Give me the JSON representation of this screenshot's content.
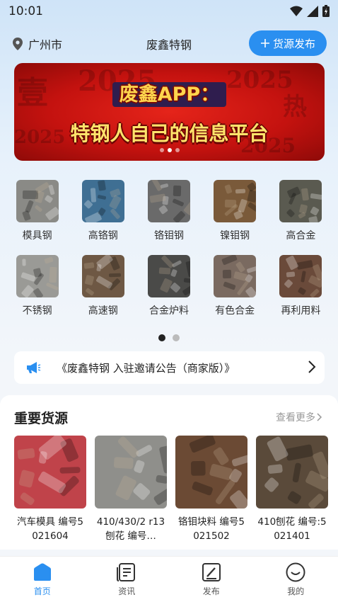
{
  "status": {
    "time": "10:01"
  },
  "header": {
    "location": "广州市",
    "title": "废鑫特钢",
    "publish_label": "货源发布"
  },
  "banner": {
    "line1": "废鑫APP：",
    "line2": "特钢人自己的信息平台",
    "slides": 3,
    "active": 1
  },
  "categories": [
    {
      "label": "模具钢",
      "tone": "#8a8a86"
    },
    {
      "label": "高铬钢",
      "tone": "#3f6f93"
    },
    {
      "label": "铬钼钢",
      "tone": "#6a6a6a"
    },
    {
      "label": "镍钼钢",
      "tone": "#7a5a3a"
    },
    {
      "label": "高合金",
      "tone": "#5a5a50"
    },
    {
      "label": "不锈钢",
      "tone": "#9a9a96"
    },
    {
      "label": "高速钢",
      "tone": "#6e5844"
    },
    {
      "label": "合金炉料",
      "tone": "#4a4a48"
    },
    {
      "label": "有色合金",
      "tone": "#7a6a60"
    },
    {
      "label": "再利用料",
      "tone": "#6a4a3a"
    }
  ],
  "category_pages": {
    "count": 2,
    "active": 0
  },
  "notice": {
    "text": "《废鑫特钢 入驻邀请公告（商家版）》"
  },
  "section": {
    "title": "重要货源",
    "more_label": "查看更多",
    "items": [
      {
        "title": "汽车模具 编号5021604",
        "tone": "#c0434a"
      },
      {
        "title": "410/430/2 r13刨花 编号…",
        "tone": "#8f8f8b"
      },
      {
        "title": "铬钼块料 编号5021502",
        "tone": "#6b4a34"
      },
      {
        "title": "410刨花 编号:5021401",
        "tone": "#5a4a3a"
      }
    ]
  },
  "tabbar": [
    {
      "label": "首页",
      "icon": "home-icon",
      "active": true
    },
    {
      "label": "资讯",
      "icon": "news-icon",
      "active": false
    },
    {
      "label": "发布",
      "icon": "publish-icon",
      "active": false
    },
    {
      "label": "我的",
      "icon": "profile-icon",
      "active": false
    }
  ],
  "colors": {
    "accent": "#2a8ff0",
    "banner_red": "#c4120f"
  }
}
